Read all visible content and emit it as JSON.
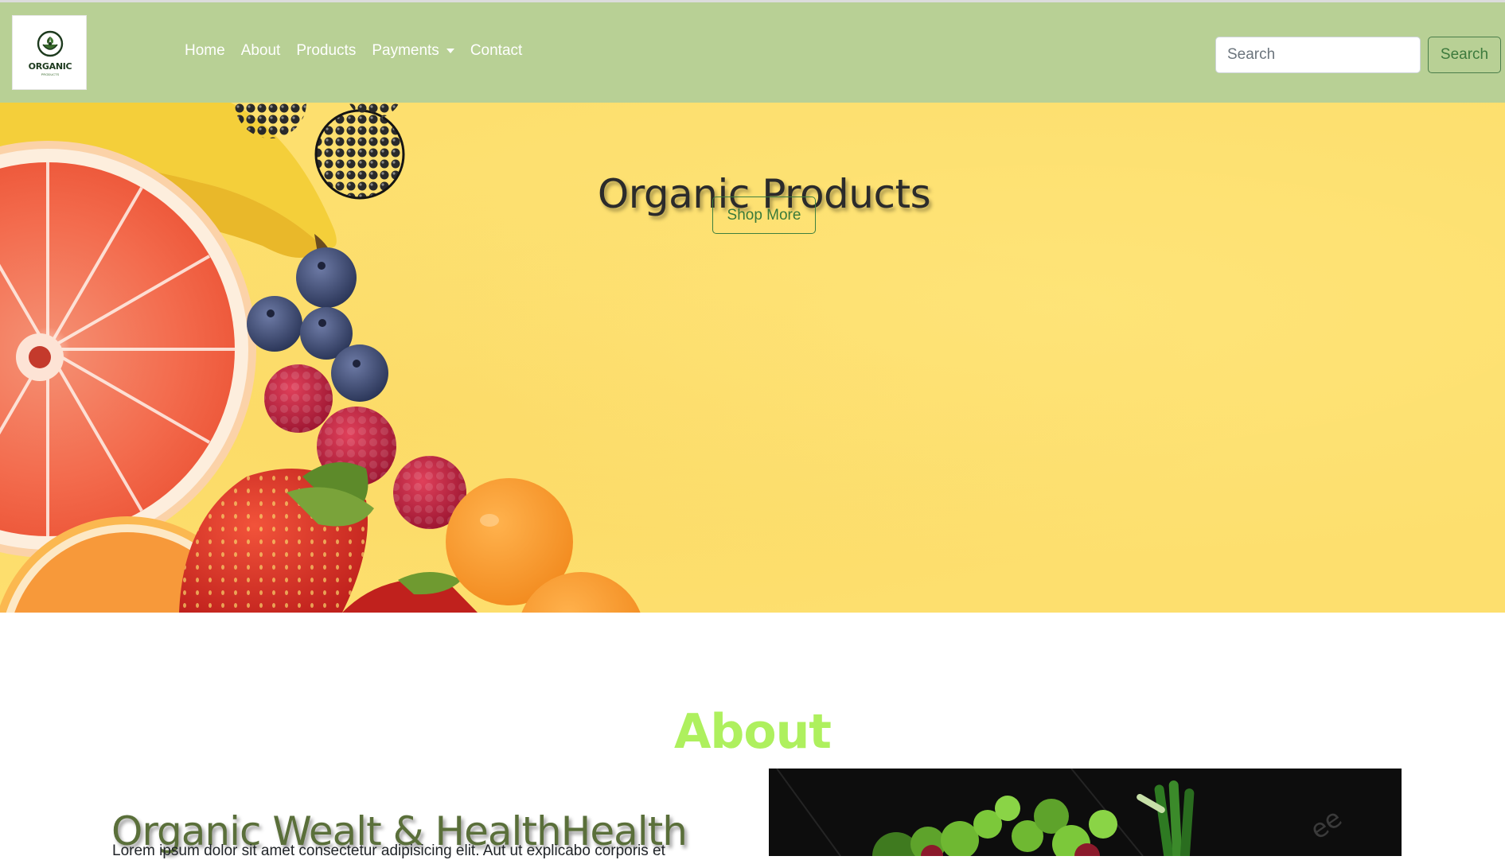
{
  "brand": {
    "logo_text": "ORGANIC",
    "logo_subtext": "PRODUCTS"
  },
  "nav": {
    "items": [
      {
        "label": "Home"
      },
      {
        "label": "About"
      },
      {
        "label": "Products"
      },
      {
        "label": "Payments",
        "dropdown": true
      },
      {
        "label": "Contact"
      }
    ]
  },
  "search": {
    "placeholder": "Search",
    "button_label": "Search"
  },
  "hero": {
    "title": "Organic Products",
    "button_label": "Shop More"
  },
  "about": {
    "title": "About",
    "subtitle": "Organic Wealt & HealthHealth",
    "text": "Lorem ipsum dolor sit amet consectetur adipisicing elit. Aut ut explicabo corporis et"
  },
  "colors": {
    "navbar_bg": "#b8d095",
    "hero_bg": "#fddf6e",
    "about_title": "#aef05e",
    "accent_green": "#3d7a3d"
  }
}
